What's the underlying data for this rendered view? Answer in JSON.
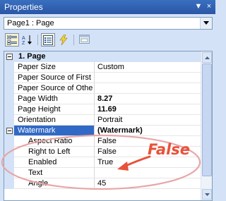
{
  "window": {
    "title": "Properties",
    "pin_glyph": "▼",
    "close_glyph": "×"
  },
  "selector": {
    "value": "Page1 : Page"
  },
  "toolbar": {
    "buttons": [
      "categorized",
      "alphabetical",
      "properties",
      "events",
      "property-pages"
    ]
  },
  "grid": {
    "category": "1. Page",
    "rows": [
      {
        "name": "Paper Size",
        "value": "Custom",
        "bold": false,
        "sub": false
      },
      {
        "name": "Paper Source of First",
        "value": "",
        "bold": false,
        "sub": false
      },
      {
        "name": "Paper Source of Othe",
        "value": "",
        "bold": false,
        "sub": false
      },
      {
        "name": "Page Width",
        "value": "8.27",
        "bold": true,
        "sub": false
      },
      {
        "name": "Page Height",
        "value": "11.69",
        "bold": true,
        "sub": false
      },
      {
        "name": "Orientation",
        "value": "Portrait",
        "bold": false,
        "sub": false
      }
    ],
    "watermark": {
      "name": "Watermark",
      "value": "(Watermark)"
    },
    "subrows": [
      {
        "name": "Aspect Ratio",
        "value": "False"
      },
      {
        "name": "Right to Left",
        "value": "False"
      },
      {
        "name": "Enabled",
        "value": "True"
      },
      {
        "name": "Text",
        "value": ""
      },
      {
        "name": "Angle",
        "value": "45"
      }
    ]
  },
  "annotation": {
    "label": "False",
    "color": "#e8523a"
  }
}
